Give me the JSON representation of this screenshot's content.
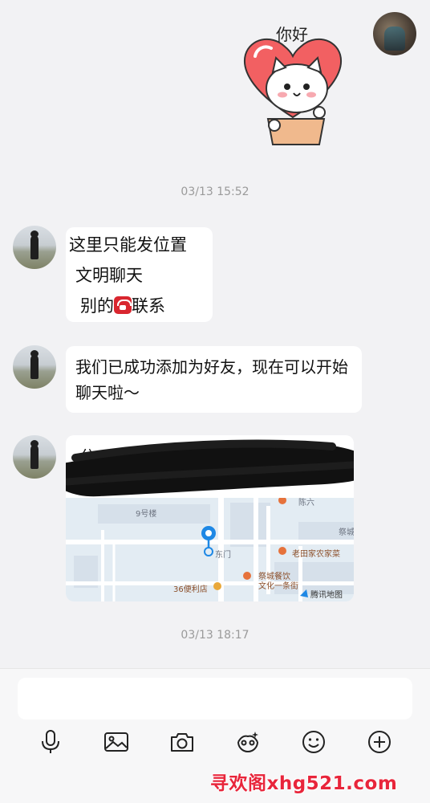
{
  "sticker": {
    "text": "你好"
  },
  "timestamps": [
    "03/13 15:52",
    "03/13 18:17"
  ],
  "messages": {
    "m1": {
      "lines": [
        "这里只能发位置",
        "文明聊天",
        "别的",
        "联系"
      ]
    },
    "m2": {
      "text": "我们已成功添加为好友，现在可以开始聊天啦～"
    },
    "m3": {
      "title_visible": "分",
      "map_labels": {
        "building": "9号楼",
        "gate": "东门",
        "restaurant": "老田家农家菜",
        "culture_street": "祭城餐饮文化一条街",
        "culture_street_line1": "祭城餐饮",
        "culture_street_line2": "文化一条街",
        "store": "36便利店",
        "corner": "祭城",
        "top_right": "陈六",
        "brand": "腾讯地图"
      }
    }
  },
  "composer": {
    "input_placeholder": "",
    "tools": [
      "microphone-icon",
      "image-icon",
      "camera-icon",
      "sticker-icon",
      "emoji-icon",
      "plus-icon"
    ]
  },
  "watermark": "寻欢阁xhg521.com",
  "colors": {
    "background": "#f2f2f4",
    "bubble": "#ffffff",
    "accent_blue": "#1e88e5",
    "watermark": "#e8253b"
  }
}
